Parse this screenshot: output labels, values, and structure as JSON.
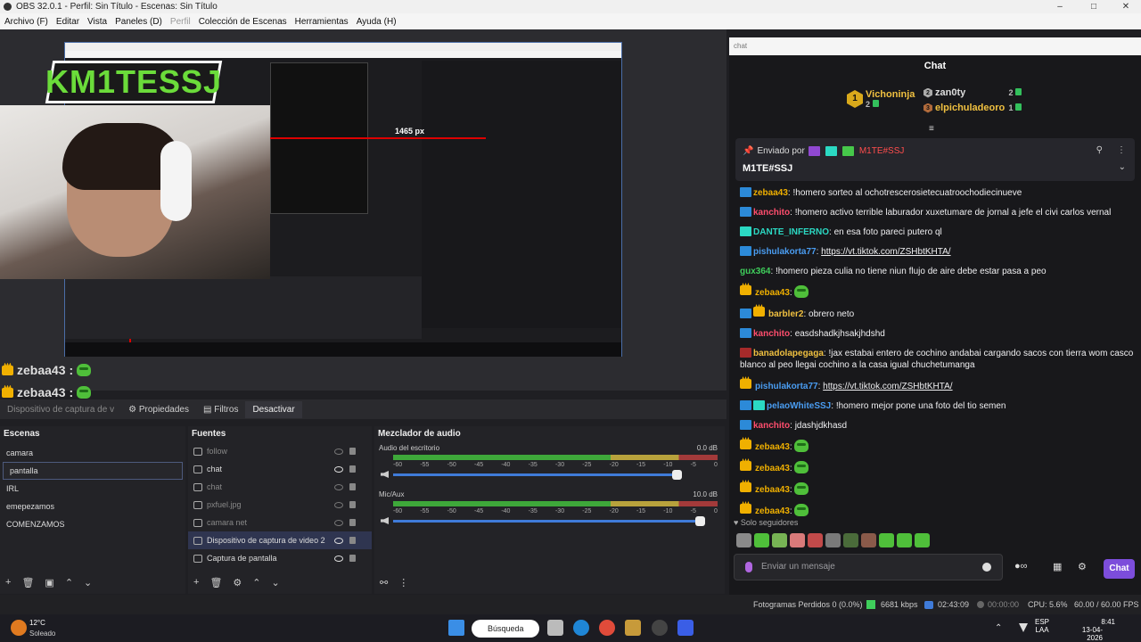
{
  "window": {
    "title": "OBS 32.0.1 - Perfil: Sin Título - Escenas: Sin Título",
    "minimize": "–",
    "maximize": "□",
    "close": "✕"
  },
  "menu": [
    "Archivo (F)",
    "Editar",
    "Vista",
    "Paneles (D)",
    "Perfil",
    "Colección de Escenas",
    "Herramientas",
    "Ayuda (H)"
  ],
  "preview": {
    "logo_text": "KM1TESSJ",
    "px_label": "1465 px"
  },
  "overlay_chat": [
    {
      "user": "zebaa43",
      "sep": ":"
    },
    {
      "user": "zebaa43",
      "sep": ":"
    },
    {
      "user": "zebaa43",
      "sep": ":"
    }
  ],
  "propbar": {
    "source": "Dispositivo de captura de v",
    "properties": "Propiedades",
    "filters": "Filtros",
    "deactivate": "Desactivar"
  },
  "scenes": {
    "title": "Escenas",
    "items": [
      "camara",
      "pantalla",
      "IRL",
      "emepezamos",
      "COMENZAMOS"
    ],
    "selected": 1
  },
  "sources": {
    "title": "Fuentes",
    "items": [
      {
        "name": "follow",
        "visible": false
      },
      {
        "name": "chat",
        "visible": true
      },
      {
        "name": "chat",
        "visible": false
      },
      {
        "name": "pxfuel.jpg",
        "visible": false
      },
      {
        "name": "camara net",
        "visible": false
      },
      {
        "name": "Dispositivo de captura de video 2",
        "visible": true
      },
      {
        "name": "Captura de pantalla",
        "visible": true
      }
    ]
  },
  "mixer": {
    "title": "Mezclador de audio",
    "tracks": [
      {
        "name": "Audio del escritorio",
        "db": "0.0 dB",
        "level": 0.88
      },
      {
        "name": "Mic/Aux",
        "db": "10.0 dB",
        "level": 0.95
      }
    ],
    "ticks": [
      "-60",
      "-55",
      "-50",
      "-45",
      "-40",
      "-35",
      "-30",
      "-25",
      "-20",
      "-15",
      "-10",
      "-5",
      "0"
    ]
  },
  "chat": {
    "header": "chat",
    "title": "Chat",
    "leaders": {
      "first": {
        "rank": "1",
        "name": "Vichoninja",
        "bits": "2"
      },
      "second": {
        "rank": "2",
        "name": "zan0ty",
        "bits": "2"
      },
      "third": {
        "rank": "3",
        "name": "elpichuladeoro",
        "bits": "1"
      }
    },
    "pinned_by_label": "Enviado por",
    "pinned_by_user": "M1TE#SSJ",
    "pinned_message": "M1TE#SSJ",
    "messages": [
      {
        "badges": [
          "prime"
        ],
        "user": "zebaa43",
        "color": "#f0b000",
        "text": "!homero sorteo al ochotrescerosietecuatroochodiecinueve"
      },
      {
        "badges": [
          "prime"
        ],
        "user": "kanchito",
        "color": "#ff4d6d",
        "text": "!homero activo terrible laburador xuxetumare de jornal a jefe el civi carlos vernal"
      },
      {
        "badges": [
          "vip"
        ],
        "user": "DANTE_INFERNO",
        "color": "#2bd9c3",
        "text": "en esa foto pareci putero ql"
      },
      {
        "badges": [
          "prime"
        ],
        "user": "pishulakorta77",
        "color": "#4a9df2",
        "text": "https://vt.tiktok.com/ZSHbtKHTA/",
        "link": true
      },
      {
        "badges": [],
        "user": "gux364",
        "color": "#3fce5b",
        "text": "!homero pieza culia no tiene niun flujo de aire debe estar pasa a peo"
      },
      {
        "badges": [
          "crown"
        ],
        "user": "zebaa43",
        "color": "#f0b000",
        "text": "",
        "emote": true
      },
      {
        "badges": [
          "prime",
          "crown"
        ],
        "user": "barbler2",
        "color": "#f0c040",
        "text": "obrero neto"
      },
      {
        "badges": [
          "prime"
        ],
        "user": "kanchito",
        "color": "#ff4d6d",
        "text": "easdshadkjhsakjhdshd"
      },
      {
        "badges": [
          "gift"
        ],
        "user": "banadolapegaga",
        "color": "#f0c040",
        "text": "!jax estabai entero de cochino andabai cargando sacos con tierra wom casco blanco al peo llegai cochino a la casa igual chuchetumanga"
      },
      {
        "badges": [
          "crown"
        ],
        "user": "pishulakorta77",
        "color": "#4a9df2",
        "text": "https://vt.tiktok.com/ZSHbtKHTA/",
        "link": true
      },
      {
        "badges": [
          "prime",
          "vip"
        ],
        "user": "pelaoWhiteSSJ",
        "color": "#4a9df2",
        "text": "!homero mejor pone una foto del tio semen"
      },
      {
        "badges": [
          "prime"
        ],
        "user": "kanchito",
        "color": "#ff4d6d",
        "text": "jdashjdkhasd"
      },
      {
        "badges": [
          "crown"
        ],
        "user": "zebaa43",
        "color": "#f0b000",
        "text": "",
        "emote": true
      },
      {
        "badges": [
          "crown"
        ],
        "user": "zebaa43",
        "color": "#f0b000",
        "text": "",
        "emote": true
      },
      {
        "badges": [
          "crown"
        ],
        "user": "zebaa43",
        "color": "#f0b000",
        "text": "",
        "emote": true
      },
      {
        "badges": [
          "crown"
        ],
        "user": "zebaa43",
        "color": "#f0b000",
        "text": "",
        "emote": true
      }
    ],
    "followers_only": "Solo seguidores",
    "input_placeholder": "Enviar un mensaje",
    "send": "Chat"
  },
  "status": {
    "dropped": "Fotogramas Perdidos 0 (0.0%)",
    "bitrate": "6681 kbps",
    "stream_time": "02:43:09",
    "rec_time": "00:00:00",
    "cpu": "CPU: 5.6%",
    "fps": "60.00 / 60.00 FPS"
  },
  "taskbar": {
    "temp": "12°C",
    "weather": "Soleado",
    "search": "Búsqueda",
    "lang1": "ESP",
    "lang2": "LAA",
    "time": "8:41",
    "date": "13-04-2026"
  }
}
